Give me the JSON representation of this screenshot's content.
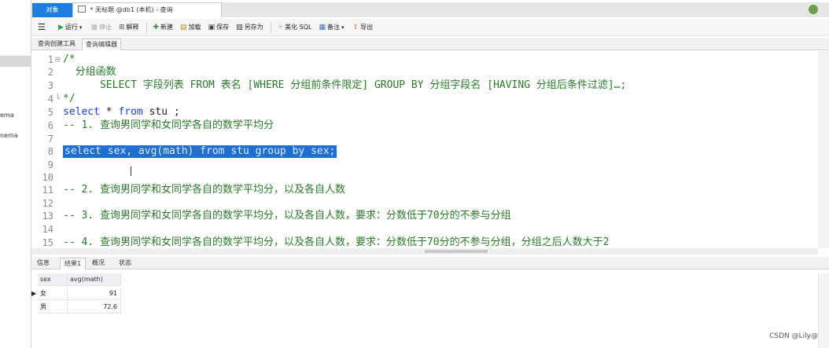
{
  "sidebar": {
    "items": [
      "ema",
      "nema"
    ]
  },
  "tabs": {
    "objects_label": "对象",
    "query_tab_label": "* 无标题 @db1 (本机) - 查询"
  },
  "toolbar": {
    "run": "运行",
    "stop": "停止",
    "explain": "解释",
    "new": "新建",
    "load": "加载",
    "save": "保存",
    "save_as": "另存为",
    "beautify": "美化 SQL",
    "comment": "备注",
    "export": "导出"
  },
  "sub_tabs": {
    "builder": "查询创建工具",
    "editor": "查询编辑器"
  },
  "editor": {
    "lines": [
      {
        "n": "1",
        "fold": "⊟",
        "text": "/*"
      },
      {
        "n": "2",
        "fold": "",
        "text": "  分组函数"
      },
      {
        "n": "3",
        "fold": "",
        "text": "      SELECT 字段列表 FROM 表名 [WHERE 分组前条件限定] GROUP BY 分组字段名 [HAVING 分组后条件过滤]…;"
      },
      {
        "n": "4",
        "fold": "└",
        "text": "*/"
      },
      {
        "n": "5",
        "fold": "",
        "kw1": "select",
        "p1": " * ",
        "kw2": "from",
        "p2": " stu ;"
      },
      {
        "n": "6",
        "fold": "",
        "text": "-- 1. 查询男同学和女同学各自的数学平均分"
      },
      {
        "n": "7",
        "fold": "",
        "text": ""
      },
      {
        "n": "8",
        "fold": "",
        "text": "select sex, avg(math) from stu group by sex;"
      },
      {
        "n": "9",
        "fold": "",
        "text": ""
      },
      {
        "n": "10",
        "fold": "",
        "text": ""
      },
      {
        "n": "11",
        "fold": "",
        "text": "-- 2. 查询男同学和女同学各自的数学平均分，以及各自人数"
      },
      {
        "n": "12",
        "fold": "",
        "text": ""
      },
      {
        "n": "13",
        "fold": "",
        "text": "-- 3. 查询男同学和女同学各自的数学平均分，以及各自人数，要求：分数低于70分的不参与分组"
      },
      {
        "n": "14",
        "fold": "",
        "text": ""
      },
      {
        "n": "15",
        "fold": "",
        "text": "-- 4. 查询男同学和女同学各自的数学平均分，以及各自人数，要求：分数低于70分的不参与分组，分组之后人数大于2"
      }
    ]
  },
  "result_tabs": [
    "信息",
    "结果1",
    "概况",
    "状态"
  ],
  "result": {
    "columns": [
      "sex",
      "avg(math)"
    ],
    "rows": [
      {
        "sex": "女",
        "avg": "91"
      },
      {
        "sex": "男",
        "avg": "72.6"
      }
    ]
  },
  "watermark": "CSDN @Lily@"
}
